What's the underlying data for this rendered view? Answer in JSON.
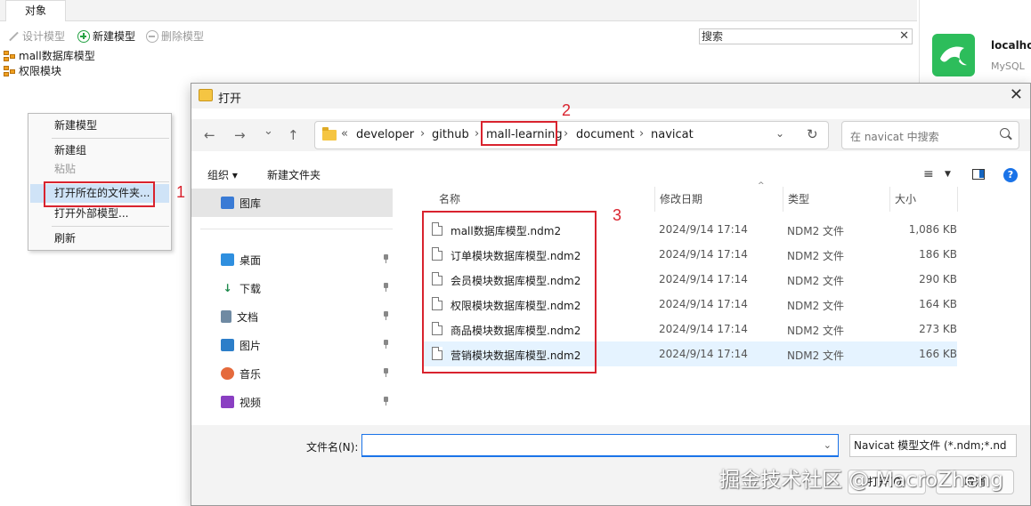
{
  "bg": {
    "tab": "对象",
    "toolbar": {
      "design": "设计模型",
      "new": "新建模型",
      "delete": "删除模型"
    },
    "search_label": "搜索",
    "search_clear": "✕",
    "tree": [
      "mall数据库模型",
      "权限模块"
    ],
    "connection": {
      "name": "localhost",
      "type": "MySQL"
    }
  },
  "context_menu": {
    "items": [
      "新建模型",
      "新建组",
      "粘贴",
      "打开所在的文件夹...",
      "打开外部模型...",
      "刷新"
    ]
  },
  "annotations": [
    "1",
    "2",
    "3"
  ],
  "dialog": {
    "title": "打开",
    "close": "✕",
    "nav": {
      "back": "←",
      "forward": "→",
      "recent": "⌄",
      "up": "↑"
    },
    "address": {
      "overflow": "«",
      "segments": [
        "developer",
        "github",
        "mall-learning",
        "document",
        "navicat"
      ]
    },
    "search_placeholder": "在 navicat 中搜索",
    "commands": {
      "organize": "组织 ▾",
      "new_folder": "新建文件夹"
    },
    "sidebar": {
      "library": "图库",
      "items": [
        "桌面",
        "下载",
        "文档",
        "图片",
        "音乐",
        "视频"
      ]
    },
    "columns": {
      "name": "名称",
      "date": "修改日期",
      "type": "类型",
      "size": "大小"
    },
    "files": [
      {
        "name": "mall数据库模型.ndm2",
        "date": "2024/9/14 17:14",
        "type": "NDM2 文件",
        "size": "1,086 KB"
      },
      {
        "name": "订单模块数据库模型.ndm2",
        "date": "2024/9/14 17:14",
        "type": "NDM2 文件",
        "size": "186 KB"
      },
      {
        "name": "会员模块数据库模型.ndm2",
        "date": "2024/9/14 17:14",
        "type": "NDM2 文件",
        "size": "290 KB"
      },
      {
        "name": "权限模块数据库模型.ndm2",
        "date": "2024/9/14 17:14",
        "type": "NDM2 文件",
        "size": "164 KB"
      },
      {
        "name": "商品模块数据库模型.ndm2",
        "date": "2024/9/14 17:14",
        "type": "NDM2 文件",
        "size": "273 KB"
      },
      {
        "name": "营销模块数据库模型.ndm2",
        "date": "2024/9/14 17:14",
        "type": "NDM2 文件",
        "size": "166 KB"
      }
    ],
    "filename_label": "文件名(N):",
    "filename_value": "",
    "filter": "Navicat 模型文件 (*.ndm;*.nd",
    "open_button": "打开(O)",
    "cancel_button": "取消"
  },
  "watermark": "掘金技术社区 @ MacroZheng",
  "colors": {
    "annotation_red": "#d9232e",
    "mysql_green": "#2dbd5b",
    "accent_blue": "#1a73e8"
  }
}
